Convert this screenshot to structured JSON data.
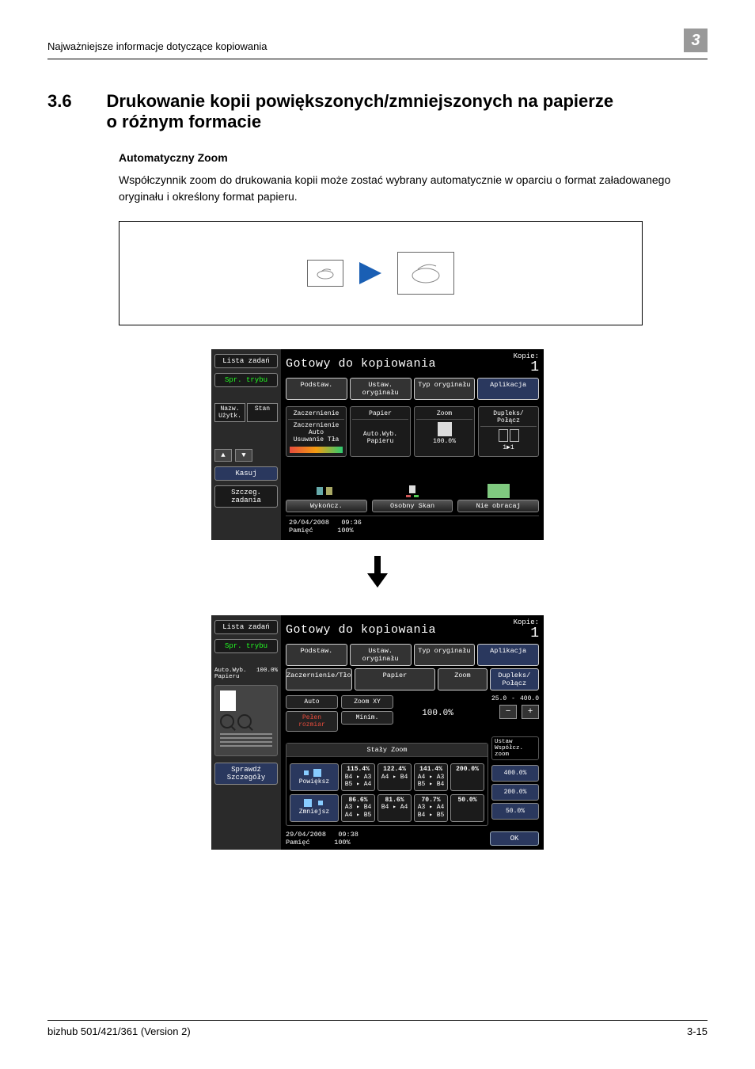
{
  "header": {
    "left": "Najważniejsze informacje dotyczące kopiowania",
    "right": "3"
  },
  "section": {
    "num": "3.6",
    "title": "Drukowanie kopii powiększonych/zmniejszonych na papierze o różnym formacie",
    "subtitle": "Automatyczny Zoom",
    "body": "Współczynnik zoom do drukowania kopii może zostać wybrany automatycznie w oparciu o format załadowanego oryginału i określony format papieru."
  },
  "screen1": {
    "side": {
      "lista": "Lista zadań",
      "spr": "Spr. trybu",
      "kasuj": "Kasuj",
      "szcz": "Szczeg. zadania",
      "tabL": "Nazw. Użytk.",
      "tabR": "Stan"
    },
    "title": "Gotowy do kopiowania",
    "kopie": {
      "label": "Kopie:",
      "num": "1"
    },
    "tabs": [
      "Podstaw.",
      "Ustaw. oryginału",
      "Typ oryginału",
      "Aplikacja"
    ],
    "panels": {
      "p1": {
        "hd": "Zaczernienie",
        "l1": "Zaczernienie",
        "l2": "Auto",
        "l3": "Usuwanie Tła"
      },
      "p2": {
        "hd": "Papier",
        "val": "Auto.Wyb. Papieru"
      },
      "p3": {
        "hd": "Zoom",
        "val": "100.0%"
      },
      "p4": {
        "hd": "Dupleks/ Połącz",
        "val": "1▶1"
      }
    },
    "foot": {
      "wyk": "Wykończ.",
      "osob": "Osobny Skan",
      "nie": "Nie obracaj"
    },
    "status": {
      "date": "29/04/2008",
      "time": "09:36",
      "mem": "Pamięć",
      "pct": "100%"
    }
  },
  "screen2": {
    "side": {
      "lista": "Lista zadań",
      "spr": "Spr. trybu",
      "auto": "Auto.Wyb. Papieru",
      "autoPct": "100.0%",
      "sprawdz": "Sprawdź Szczegóły"
    },
    "title": "Gotowy do kopiowania",
    "kopie": {
      "label": "Kopie:",
      "num": "1"
    },
    "tabs": [
      "Podstaw.",
      "Ustaw. oryginału",
      "Typ oryginału",
      "Aplikacja"
    ],
    "subtabs": {
      "zt": "Zaczernienie/Tło",
      "pap": "Papier",
      "zoom": "Zoom",
      "dup": "Dupleks/ Połącz"
    },
    "zoombtns": {
      "auto": "Auto",
      "xy": "Zoom XY",
      "pelen": "Pełen rozmiar",
      "min": "Minim."
    },
    "pct": "100.0%",
    "range": {
      "lo": "25.0",
      "sep": "-",
      "hi": "400.0"
    },
    "staly": "Stały Zoom",
    "ustaw": "Ustaw Współcz. zoom",
    "enlarge": {
      "label": "Powiększ",
      "cells": [
        {
          "p": "115.4%",
          "s": "B4 ▸ A3  B5 ▸ A4"
        },
        {
          "p": "122.4%",
          "s": "A4 ▸ B4"
        },
        {
          "p": "141.4%",
          "s": "A4 ▸ A3  B5 ▸ B4"
        },
        {
          "p": "200.0%",
          "s": ""
        }
      ]
    },
    "reduce": {
      "label": "Zmniejsz",
      "cells": [
        {
          "p": "86.6%",
          "s": "A3 ▸ B4  A4 ▸ B5"
        },
        {
          "p": "81.6%",
          "s": "B4 ▸ A4"
        },
        {
          "p": "70.7%",
          "s": "A3 ▸ A4  B4 ▸ B5"
        },
        {
          "p": "50.0%",
          "s": ""
        }
      ]
    },
    "presets": [
      "400.0%",
      "200.0%",
      "50.0%"
    ],
    "ok": "OK",
    "status": {
      "date": "29/04/2008",
      "time": "09:38",
      "mem": "Pamięć",
      "pct": "100%"
    }
  },
  "footer": {
    "left": "bizhub 501/421/361 (Version 2)",
    "right": "3-15"
  }
}
